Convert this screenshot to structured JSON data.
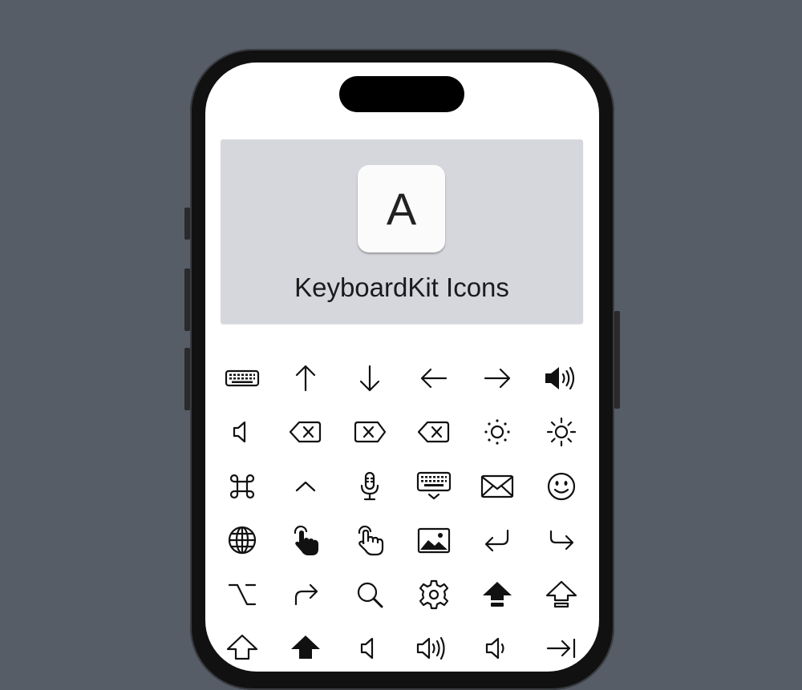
{
  "header": {
    "key_letter": "A",
    "title": "KeyboardKit Icons"
  },
  "icons": [
    "keyboard-icon",
    "arrow-up-icon",
    "arrow-down-icon",
    "arrow-left-icon",
    "arrow-right-icon",
    "speaker-loud-icon",
    "speaker-icon",
    "delete-left-icon",
    "delete-left-icon",
    "delete-left-icon",
    "brightness-low-icon",
    "brightness-high-icon",
    "command-icon",
    "control-icon",
    "microphone-icon",
    "keyboard-dismiss-icon",
    "envelope-icon",
    "emoji-face-icon",
    "globe-icon",
    "tap-hand-filled-icon",
    "tap-hand-icon",
    "photo-icon",
    "return-icon",
    "redo-icon",
    "option-icon",
    "redo-arrow-icon",
    "search-icon",
    "settings-gear-icon",
    "shift-filled-icon",
    "shift-icon",
    "shift-icon",
    "shift-filled-icon",
    "speaker-icon",
    "speaker-wave-icon",
    "speaker-low-icon",
    "tab-right-icon"
  ]
}
